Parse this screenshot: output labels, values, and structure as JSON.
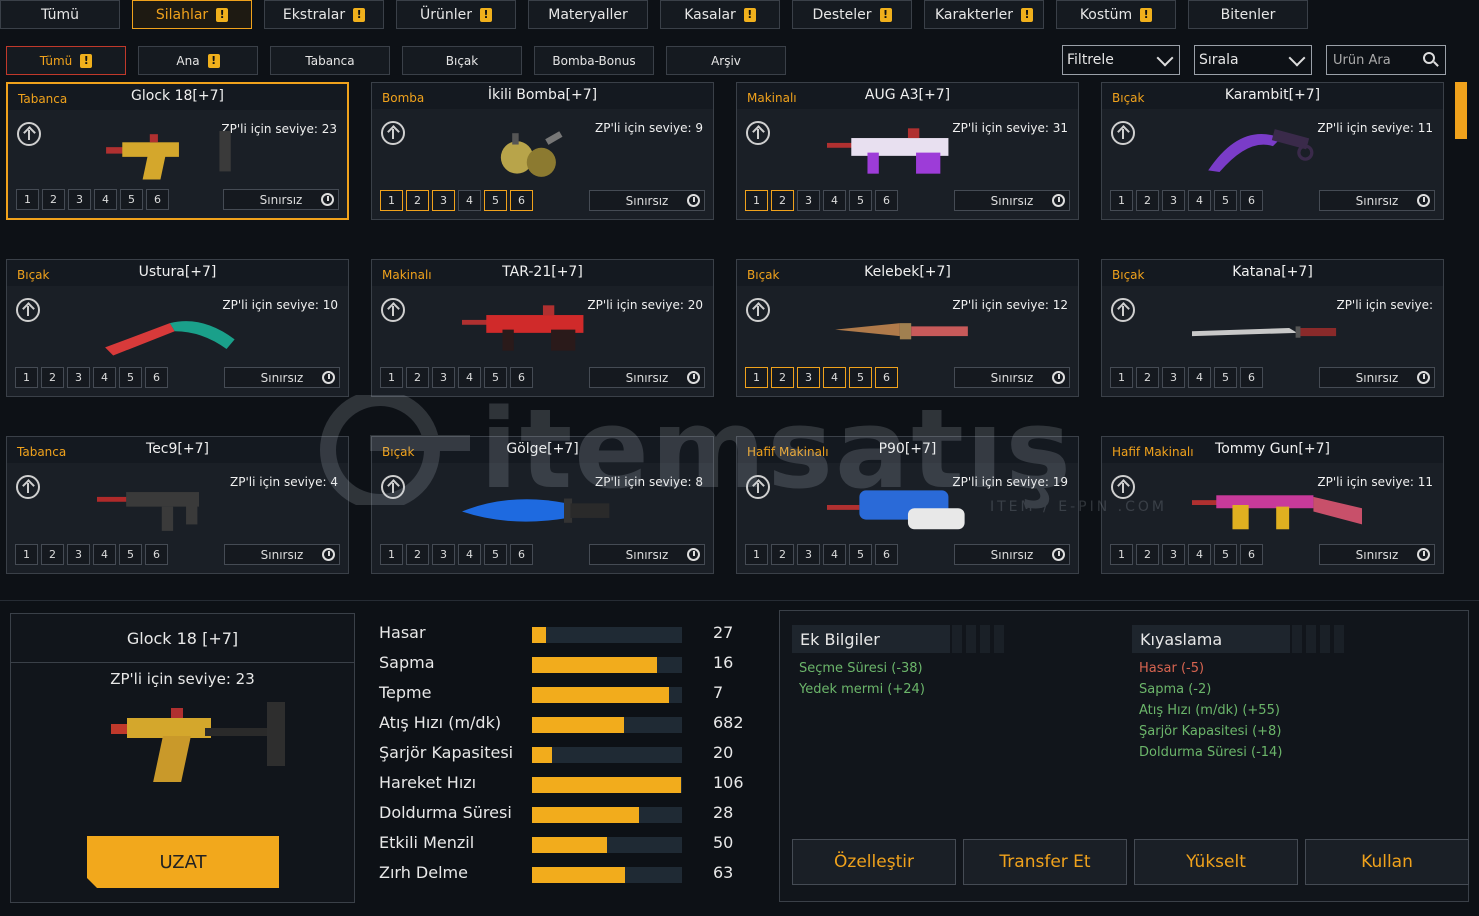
{
  "tabs": [
    {
      "label": "Tümü",
      "warn": false,
      "active": false
    },
    {
      "label": "Silahlar",
      "warn": true,
      "active": true
    },
    {
      "label": "Ekstralar",
      "warn": true,
      "active": false
    },
    {
      "label": "Ürünler",
      "warn": true,
      "active": false
    },
    {
      "label": "Materyaller",
      "warn": false,
      "active": false
    },
    {
      "label": "Kasalar",
      "warn": true,
      "active": false
    },
    {
      "label": "Desteler",
      "warn": true,
      "active": false
    },
    {
      "label": "Karakterler",
      "warn": true,
      "active": false
    },
    {
      "label": "Kostüm",
      "warn": true,
      "active": false
    },
    {
      "label": "Bitenler",
      "warn": false,
      "active": false
    }
  ],
  "subtabs": [
    {
      "label": "Tümü",
      "warn": true,
      "active": true
    },
    {
      "label": "Ana",
      "warn": true,
      "active": false
    },
    {
      "label": "Tabanca",
      "warn": false,
      "active": false
    },
    {
      "label": "Bıçak",
      "warn": false,
      "active": false
    },
    {
      "label": "Bomba-Bonus",
      "warn": false,
      "active": false
    },
    {
      "label": "Arşiv",
      "warn": false,
      "active": false
    }
  ],
  "warn_glyph": "!",
  "filter": {
    "label": "Filtrele"
  },
  "sort": {
    "label": "Sırala"
  },
  "search": {
    "placeholder": "Ürün Ara"
  },
  "watermark": {
    "text": "itemsatış",
    "sub": "ITEM / E-PIN .COM"
  },
  "items": [
    {
      "cat": "Tabanca",
      "name": "Glock 18[+7]",
      "zp": "ZP'li için seviye: 23",
      "on": [],
      "limit": "Sınırsız",
      "selected": true,
      "art": "pistol",
      "c1": "#d4a72c",
      "c2": "#b03030"
    },
    {
      "cat": "Bomba",
      "name": "İkili Bomba[+7]",
      "zp": "ZP'li için seviye: 9",
      "on": [
        1,
        2,
        3,
        5,
        6
      ],
      "limit": "Sınırsız",
      "selected": false,
      "art": "grenade",
      "c1": "#b8a44a",
      "c2": "#8c7a30"
    },
    {
      "cat": "Makinalı",
      "name": "AUG A3[+7]",
      "zp": "ZP'li için seviye: 31",
      "on": [
        1,
        2
      ],
      "limit": "Sınırsız",
      "selected": false,
      "art": "rifle",
      "c1": "#e8e0f0",
      "c2": "#9d3cd8"
    },
    {
      "cat": "Bıçak",
      "name": "Karambit[+7]",
      "zp": "ZP'li için seviye: 11",
      "on": [],
      "limit": "Sınırsız",
      "selected": false,
      "art": "karambit",
      "c1": "#7a3cc8",
      "c2": "#3a2a4a"
    },
    {
      "cat": "Bıçak",
      "name": "Ustura[+7]",
      "zp": "ZP'li için seviye: 10",
      "on": [],
      "limit": "Sınırsız",
      "selected": false,
      "art": "razor",
      "c1": "#1aa08a",
      "c2": "#d83a3a"
    },
    {
      "cat": "Makinalı",
      "name": "TAR-21[+7]",
      "zp": "ZP'li için seviye: 20",
      "on": [],
      "limit": "Sınırsız",
      "selected": false,
      "art": "rifle",
      "c1": "#d02a2a",
      "c2": "#2a1a1a"
    },
    {
      "cat": "Bıçak",
      "name": "Kelebek[+7]",
      "zp": "ZP'li için seviye: 12",
      "on": [
        1,
        2,
        3,
        4,
        5,
        6
      ],
      "limit": "Sınırsız",
      "selected": false,
      "art": "knife",
      "c1": "#b07a4a",
      "c2": "#c85a5a"
    },
    {
      "cat": "Bıçak",
      "name": "Katana[+7]",
      "zp": "ZP'li için seviye: ",
      "on": [],
      "limit": "Sınırsız",
      "selected": false,
      "art": "katana",
      "c1": "#c8c8c8",
      "c2": "#8a2a2a"
    },
    {
      "cat": "Tabanca",
      "name": "Tec9[+7]",
      "zp": "ZP'li için seviye: 4",
      "on": [],
      "limit": "Sınırsız",
      "selected": false,
      "art": "smg",
      "c1": "#3a3a3a",
      "c2": "#b02a2a"
    },
    {
      "cat": "Bıçak",
      "name": "Gölge[+7]",
      "zp": "ZP'li için seviye: 8",
      "on": [],
      "limit": "Sınırsız",
      "selected": false,
      "art": "dagger",
      "c1": "#1e6ae0",
      "c2": "#2a2a2a"
    },
    {
      "cat": "Hafif Makinalı",
      "name": "P90[+7]",
      "zp": "ZP'li için seviye: 19",
      "on": [],
      "limit": "Sınırsız",
      "selected": false,
      "art": "p90",
      "c1": "#2a6ad8",
      "c2": "#e8e8e8"
    },
    {
      "cat": "Hafif Makinalı",
      "name": "Tommy Gun[+7]",
      "zp": "ZP'li için seviye: 11",
      "on": [],
      "limit": "Sınırsız",
      "selected": false,
      "art": "tommy",
      "c1": "#c83a9a",
      "c2": "#e0b020"
    }
  ],
  "slot_labels": [
    "1",
    "2",
    "3",
    "4",
    "5",
    "6"
  ],
  "detail": {
    "name": "Glock 18 [+7]",
    "zp": "ZP'li için seviye: 23",
    "extend_button": "UZAT",
    "stats": [
      {
        "label": "Hasar",
        "value": "27",
        "fill": 0.09
      },
      {
        "label": "Sapma",
        "value": "16",
        "fill": 0.83
      },
      {
        "label": "Tepme",
        "value": "7",
        "fill": 0.91
      },
      {
        "label": "Atış Hızı (m/dk)",
        "value": "682",
        "fill": 0.61
      },
      {
        "label": "Şarjör Kapasitesi",
        "value": "20",
        "fill": 0.13
      },
      {
        "label": "Hareket Hızı",
        "value": "106",
        "fill": 0.99
      },
      {
        "label": "Doldurma Süresi",
        "value": "28",
        "fill": 0.71
      },
      {
        "label": "Etkili Menzil",
        "value": "50",
        "fill": 0.5
      },
      {
        "label": "Zırh Delme",
        "value": "63",
        "fill": 0.62
      }
    ]
  },
  "extra_info": {
    "title": "Ek Bilgiler",
    "lines": [
      {
        "text": "Seçme Süresi (-38)",
        "color": "green"
      },
      {
        "text": "Yedek mermi (+24)",
        "color": "green"
      }
    ]
  },
  "compare": {
    "title": "Kıyaslama",
    "lines": [
      {
        "text": "Hasar (-5)",
        "color": "red"
      },
      {
        "text": "Sapma (-2)",
        "color": "green"
      },
      {
        "text": "Atış Hızı (m/dk) (+55)",
        "color": "green"
      },
      {
        "text": "Şarjör Kapasitesi (+8)",
        "color": "green"
      },
      {
        "text": "Doldurma Süresi (-14)",
        "color": "green"
      }
    ]
  },
  "actions": [
    "Özelleştir",
    "Transfer Et",
    "Yükselt",
    "Kullan"
  ]
}
